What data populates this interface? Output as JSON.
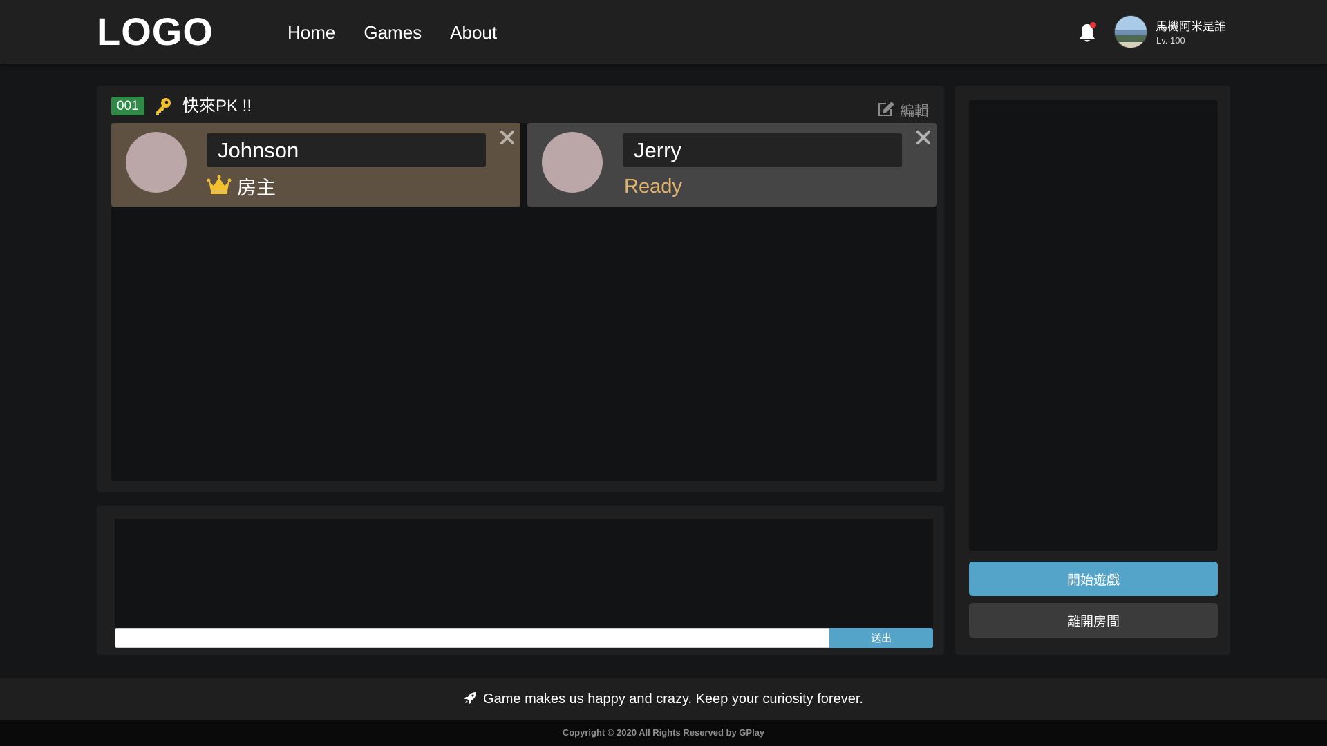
{
  "header": {
    "logo": "LOGO",
    "nav": [
      {
        "label": "Home"
      },
      {
        "label": "Games"
      },
      {
        "label": "About"
      }
    ],
    "notification_icon": "bell-icon",
    "user": {
      "name": "馬機阿米是誰",
      "level": "Lv. 100"
    }
  },
  "room": {
    "id": "001",
    "lock_icon": "key-icon",
    "title": "快來PK !!",
    "edit_label": "編輯",
    "players": [
      {
        "name": "Johnson",
        "role": "房主",
        "role_icon": "crown-icon"
      },
      {
        "name": "Jerry",
        "status": "Ready"
      }
    ]
  },
  "chat": {
    "input_value": "",
    "send_label": "送出"
  },
  "side": {
    "start_label": "開始遊戲",
    "leave_label": "離開房間"
  },
  "footer": {
    "tagline": "Game makes us happy and crazy. Keep your curiosity forever.",
    "copyright": "Copyright © 2020 All Rights Reserved by GPlay"
  },
  "colors": {
    "room_id_badge": "#2e8a46",
    "host_card": "#5f5142",
    "guest_card": "#454545",
    "ready_status": "#e3b26b",
    "primary_button": "#54a3c9",
    "crown": "#f2c12e",
    "notification_dot": "#e5323b"
  }
}
